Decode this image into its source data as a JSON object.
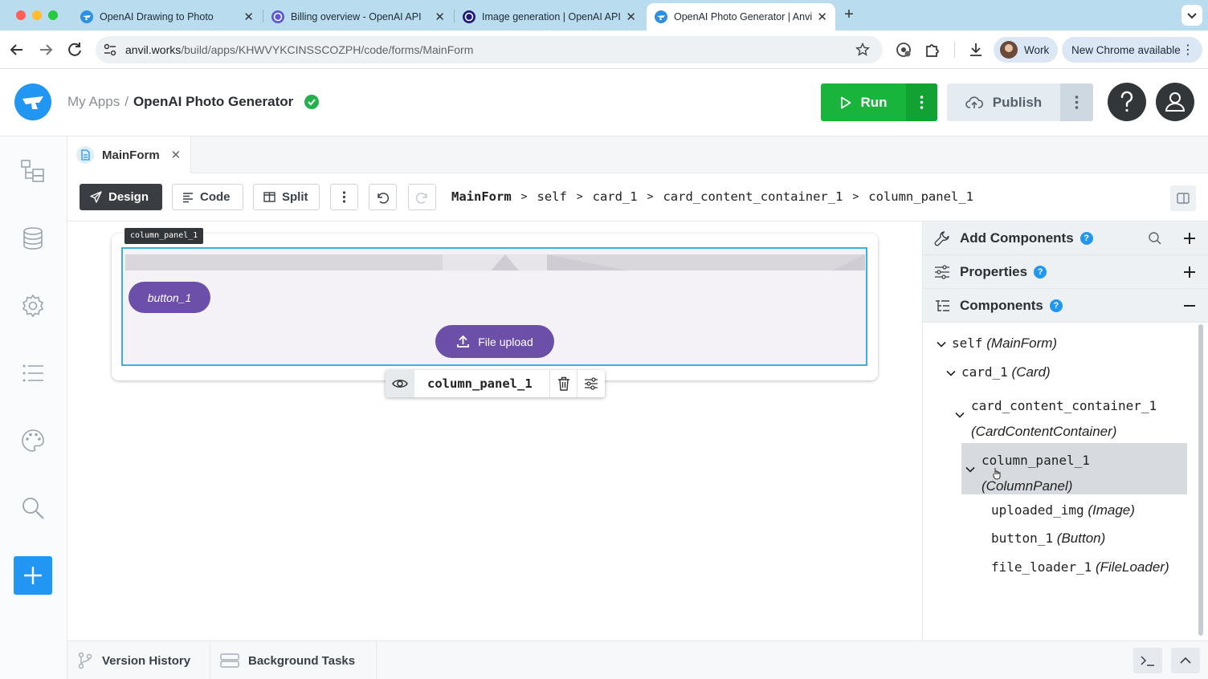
{
  "browser": {
    "tabs": [
      {
        "title": "OpenAI Drawing to Photo",
        "active": false
      },
      {
        "title": "Billing overview - OpenAI API",
        "active": false
      },
      {
        "title": "Image generation | OpenAI API",
        "active": false
      },
      {
        "title": "OpenAI Photo Generator | Anvil",
        "active": true
      }
    ],
    "url_host": "anvil.works",
    "url_path": "/build/apps/KHWVYKCINSSCOZPH/code/forms/MainForm",
    "profile_label": "Work",
    "update_label": "New Chrome available"
  },
  "header": {
    "my_apps": "My Apps",
    "separator": "/",
    "app_name": "OpenAI Photo Generator",
    "run_label": "Run",
    "publish_label": "Publish"
  },
  "editor": {
    "file_tab": "MainForm",
    "modes": {
      "design": "Design",
      "code": "Code",
      "split": "Split"
    },
    "breadcrumb": [
      "MainForm",
      "self",
      "card_1",
      "card_content_container_1",
      "column_panel_1"
    ],
    "breadcrumb_sep": ">"
  },
  "canvas": {
    "selected_label": "column_panel_1",
    "button_text": "button_1",
    "file_upload_text": "File upload",
    "toolbar_name": "column_panel_1"
  },
  "right_panel": {
    "add_components": "Add Components",
    "properties": "Properties",
    "components": "Components",
    "help_glyph": "?",
    "tree": [
      {
        "name": "self",
        "type": "(MainForm)"
      },
      {
        "name": "card_1",
        "type": "(Card)"
      },
      {
        "name": "card_content_container_1",
        "type": "(CardContentContainer)"
      },
      {
        "name": "column_panel_1",
        "type": "(ColumnPanel)"
      },
      {
        "name": "uploaded_img",
        "type": "(Image)"
      },
      {
        "name": "button_1",
        "type": "(Button)"
      },
      {
        "name": "file_loader_1",
        "type": "(FileLoader)"
      }
    ]
  },
  "bottom": {
    "version_history": "Version History",
    "background_tasks": "Background Tasks"
  },
  "colors": {
    "anvil_blue": "#2196f3",
    "run_green": "#18b43c",
    "material_purple": "#6b4fa8",
    "selection_outline": "#39b0e0"
  }
}
